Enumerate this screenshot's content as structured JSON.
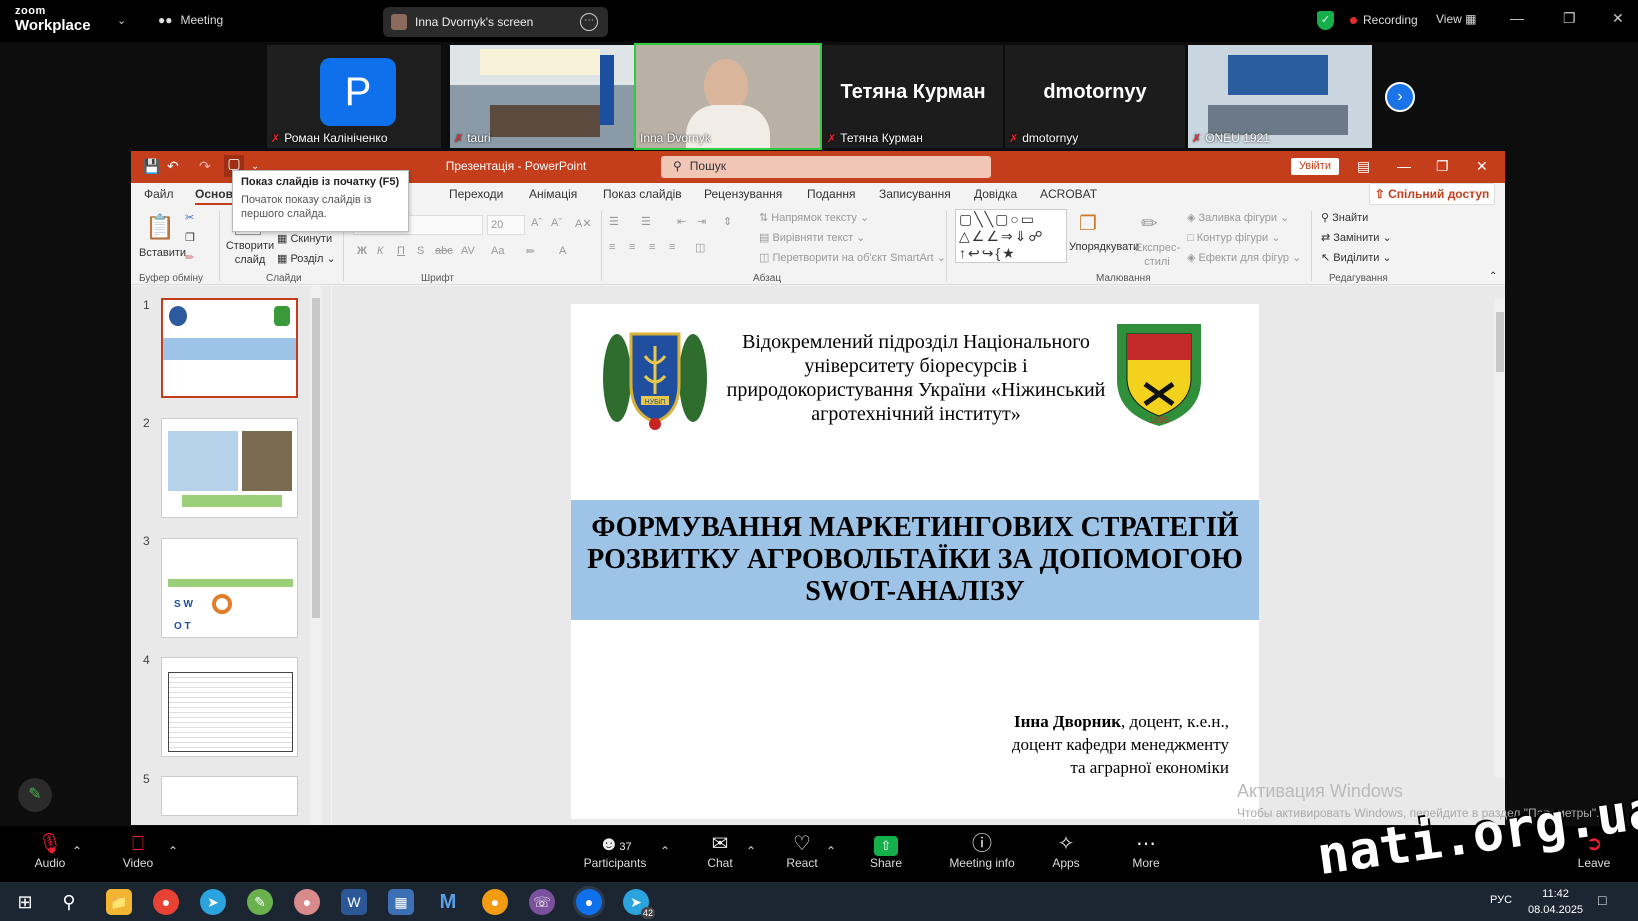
{
  "zoom": {
    "brand_small": "zoom",
    "brand": "Workplace",
    "meeting_label": "Meeting",
    "screen_pill": "Inna Dvornyk's screen",
    "recording": "Recording",
    "view": "View"
  },
  "participants_strip": [
    {
      "name": "Роман Калініченко",
      "avatar_letter": "P"
    },
    {
      "name": "tauri"
    },
    {
      "name": "Inna Dvornyk"
    },
    {
      "name": "Тетяна Курман",
      "display": "Тетяна Курман"
    },
    {
      "name": "dmotornyy",
      "display": "dmotornyy"
    },
    {
      "name": "ONEU 1921"
    }
  ],
  "ppt": {
    "title": "Презентація  -  PowerPoint",
    "search_placeholder": "Пошук",
    "signin": "Увійти",
    "share": "Спільний доступ",
    "tabs": [
      "Файл",
      "Основн",
      "Вставлення",
      "Конструктор",
      "Переходи",
      "Анімація",
      "Показ слайдів",
      "Рецензування",
      "Подання",
      "Записування",
      "Довідка",
      "ACROBAT"
    ],
    "tooltip_title": "Показ слайдів із початку (F5)",
    "tooltip_body": "Початок показу слайдів із першого слайда.",
    "ribbon": {
      "paste": "Вставити",
      "clipboard": "Буфер обміну",
      "new_slide": "Створити слайд",
      "reset": "Скинути",
      "section": "Розділ",
      "slides": "Слайди",
      "font_size": "20",
      "font": "Шрифт",
      "text_direction": "Напрямок тексту",
      "align_text": "Вирівняти текст",
      "smartart": "Перетворити на об'єкт SmartArt",
      "paragraph": "Абзац",
      "arrange": "Упорядкувати",
      "quick_styles": "Експрес-стилі",
      "shape_fill": "Заливка фігури",
      "shape_outline": "Контур фігури",
      "shape_effects": "Ефекти для фігур",
      "drawing": "Малювання",
      "find": "Знайти",
      "replace": "Замінити",
      "select": "Виділити",
      "editing": "Редагування"
    },
    "slide_numbers": [
      "1",
      "2",
      "3",
      "4",
      "5"
    ],
    "slide": {
      "org": "Відокремлений підрозділ Національного університету біоресурсів і природокористування України «Ніжинський агротехнічний інститут»",
      "title": "ФОРМУВАННЯ МАРКЕТИНГОВИХ СТРАТЕГІЙ РОЗВИТКУ АГРОВОЛЬТАЇКИ ЗА ДОПОМОГОЮ SWOT-АНАЛІЗУ",
      "author_name": "Інна Дворник",
      "author_line1": ", доцент, к.е.н.,",
      "author_line2": "доцент кафедри менеджменту",
      "author_line3": "та аграрної економіки",
      "logo_left_text": "НУБіП",
      "logo_right_year": "1895"
    },
    "activation_title": "Активация Windows",
    "activation_body": "Чтобы активировать Windows, перейдите в раздел \"Параметры\"."
  },
  "zoom_bar": {
    "audio": "Audio",
    "video": "Video",
    "participants": "Participants",
    "participants_count": "37",
    "chat": "Chat",
    "react": "React",
    "share": "Share",
    "meeting_info": "Meeting info",
    "apps": "Apps",
    "more": "More",
    "leave": "Leave"
  },
  "taskbar": {
    "lang": "РУС",
    "time": "11:42",
    "date": "08.04.2025",
    "telegram_badge": "42"
  },
  "watermark": "nati.org.ua"
}
